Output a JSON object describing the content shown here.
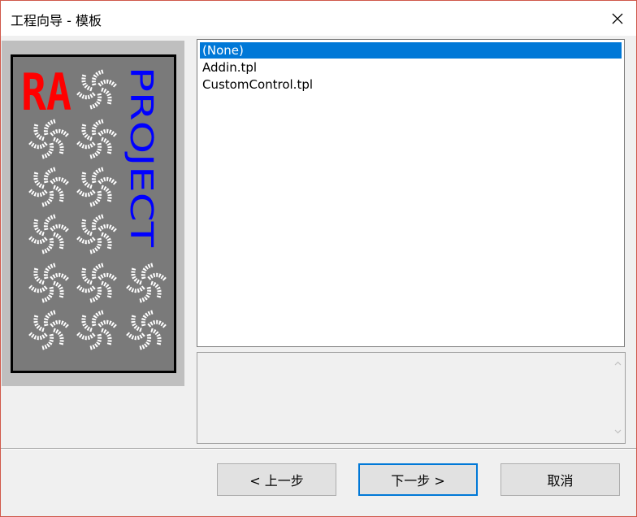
{
  "window": {
    "title": "工程向导 - 模板"
  },
  "banner": {
    "logo_text": "RA",
    "vertical_text": "PROJECT"
  },
  "templates": {
    "items": [
      "(None)",
      "Addin.tpl",
      "CustomControl.tpl"
    ],
    "selected_index": 0
  },
  "buttons": {
    "back_label": "< 上一步",
    "next_label": "下一步 >",
    "cancel_label": "取消"
  },
  "colors": {
    "selection": "#0078d7",
    "banner_text": "#0000ff",
    "logo": "#ff0000",
    "window_border": "#d0584a"
  },
  "icons": {
    "close": "close-icon",
    "scroll_up": "chevron-up-icon",
    "scroll_down": "chevron-down-icon"
  }
}
